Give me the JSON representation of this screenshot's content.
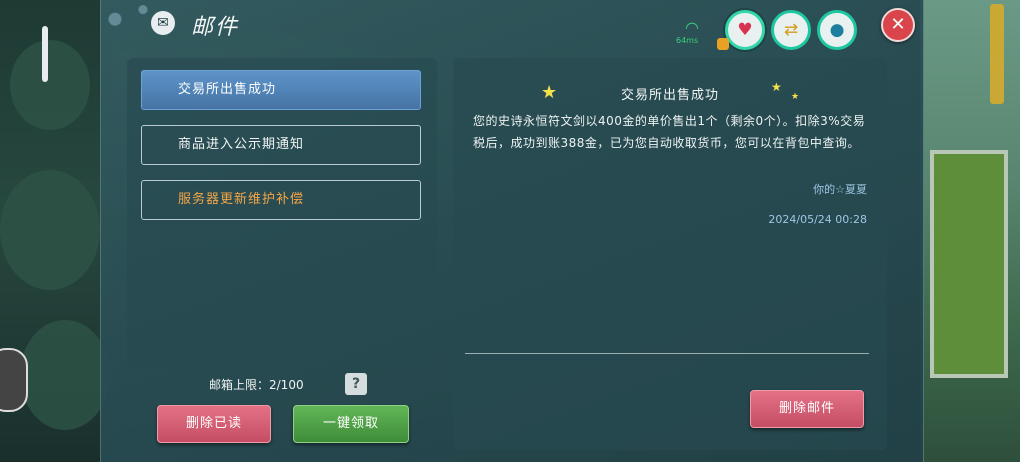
{
  "window": {
    "title": "邮件"
  },
  "status": {
    "network": "64ms",
    "icons": [
      "signal-icon",
      "heart-icon",
      "coin-swap-icon",
      "water-drop-icon"
    ]
  },
  "mail_list": {
    "items": [
      {
        "label": "交易所出售成功",
        "state": "selected"
      },
      {
        "label": "商品进入公示期通知",
        "state": "normal"
      },
      {
        "label": "服务器更新维护补偿",
        "state": "highlight"
      }
    ],
    "capacity_label": "邮箱上限：2/100",
    "help_glyph": "?"
  },
  "mail_detail": {
    "title": "交易所出售成功",
    "body": "您的史诗永恒符文剑以400金的单价售出1个（剩余0个）。扣除3%交易税后，成功到账388金，已为您自动收取货币，您可以在背包中查询。",
    "sender": "你的☆夏夏",
    "date": "2024/05/24 00:28"
  },
  "buttons": {
    "delete_read": "删除已读",
    "claim_all": "一键领取",
    "delete_mail": "删除邮件",
    "close_glyph": "✕"
  },
  "colors": {
    "selected_item": "#5e94c9",
    "highlight_text": "#f3a648",
    "red_button": "#d45e74",
    "green_button": "#4fa047",
    "date_text": "#9fc7e4"
  }
}
